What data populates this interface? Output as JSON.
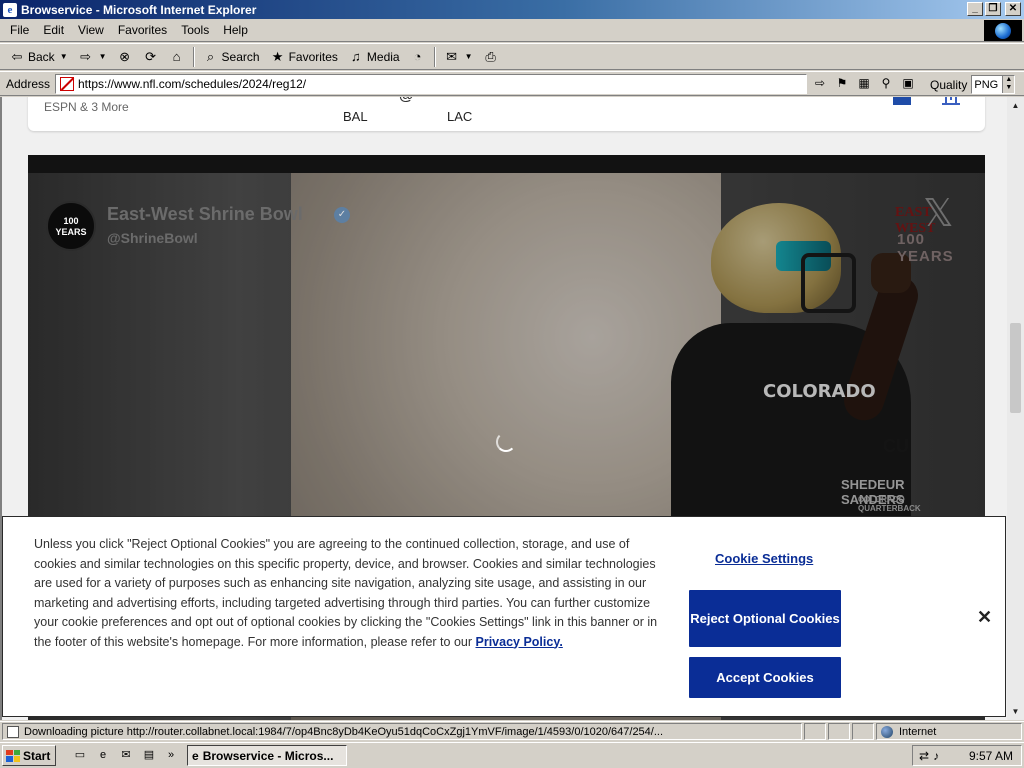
{
  "window": {
    "title": "Browservice - Microsoft Internet Explorer",
    "buttons": {
      "minimize": "_",
      "restore": "❐",
      "close": "✕"
    }
  },
  "menubar": {
    "items": [
      "File",
      "Edit",
      "View",
      "Favorites",
      "Tools",
      "Help"
    ]
  },
  "toolbar": {
    "back": "Back",
    "search": "Search",
    "favorites": "Favorites",
    "media": "Media"
  },
  "address": {
    "label": "Address",
    "url": "https://www.nfl.com/schedules/2024/reg12/",
    "quality_label": "Quality",
    "quality_value": "PNG"
  },
  "game": {
    "network": "ESPN & 3 More",
    "away": "BAL",
    "separator": "@",
    "home": "LAC"
  },
  "tweet": {
    "name": "East-West Shrine Bowl",
    "handle": "@ShrineBowl",
    "avatar_text": "100 YEARS",
    "platform_logo": "𝕏",
    "image_brand": "EAST WEST",
    "image_years": "100 YEARS",
    "image_jersey": "COLORADO",
    "image_caption": "SHEDEUR SANDERS",
    "image_subcaption": "COLORADO QUARTERBACK"
  },
  "cookie": {
    "text_main": "Unless you click \"Reject Optional Cookies\" you are agreeing to the continued collection, storage, and use of cookies and similar technologies on this specific property, device, and browser. Cookies and similar technologies are used for a variety of purposes such as enhancing site navigation, analyzing site usage, and assisting in our marketing and advertising efforts, including targeted advertising through third parties. You can further customize your cookie preferences and opt out of optional cookies by clicking the \"Cookies Settings\" link in this banner or in the footer of this website's homepage. For more information, please refer to our ",
    "privacy_link": "Privacy Policy.",
    "settings": "Cookie Settings",
    "reject": "Reject Optional Cookies",
    "accept": "Accept Cookies",
    "close": "✕"
  },
  "status": {
    "text": "Downloading picture http://router.collabnet.local:1984/7/op4Bnc8yDb4KeOyu51dqCoCxZgj1YmVF/image/1/4593/0/1020/647/254/...",
    "zone": "Internet"
  },
  "taskbar": {
    "start": "Start",
    "task": "Browservice - Micros...",
    "clock": "9:57 AM"
  },
  "colors": {
    "titlebar_start": "#0a246a",
    "cookie_button": "#0a2d96",
    "chrome": "#d4d0c8"
  }
}
